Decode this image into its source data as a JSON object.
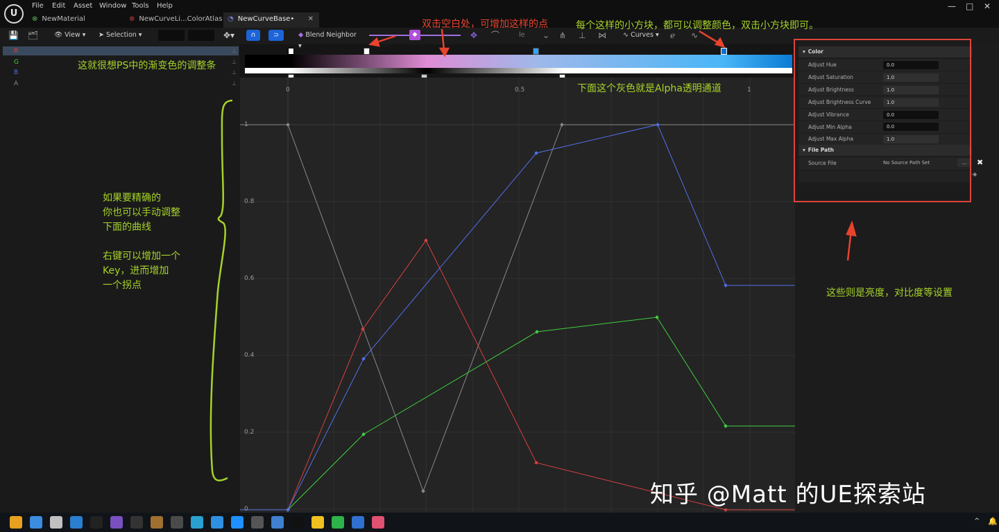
{
  "menu": [
    "File",
    "Edit",
    "Asset",
    "Window",
    "Tools",
    "Help"
  ],
  "tabs": [
    {
      "label": "NewMaterial",
      "active": false
    },
    {
      "label": "NewCurveLi...ColorAtlas•",
      "active": false
    },
    {
      "label": "NewCurveBase•",
      "active": true
    }
  ],
  "window_controls": {
    "minimize": "—",
    "maximize": "□",
    "close": "✕"
  },
  "toolbar": {
    "view_label": "View",
    "selection_label": "Selection",
    "blend_label": "Blend Neighbor",
    "curves_label": "Curves",
    "scale_partial": "le"
  },
  "channels": [
    {
      "label": "R",
      "color": "#d94040"
    },
    {
      "label": "G",
      "color": "#40d040"
    },
    {
      "label": "B",
      "color": "#5070e8"
    },
    {
      "label": "A",
      "color": "#8a8a8a"
    }
  ],
  "graph": {
    "x_ticks": [
      "0",
      "0.5",
      "1"
    ],
    "y_ticks": [
      "1",
      "0.8",
      "0.6",
      "0.4",
      "0.2",
      "0"
    ]
  },
  "details": {
    "color_section": "Color",
    "rows": [
      {
        "label": "Adjust Hue",
        "value": "0.0"
      },
      {
        "label": "Adjust Saturation",
        "value": "1.0"
      },
      {
        "label": "Adjust Brightness",
        "value": "1.0"
      },
      {
        "label": "Adjust Brightness Curve",
        "value": "1.0"
      },
      {
        "label": "Adjust Vibrance",
        "value": "0.0"
      },
      {
        "label": "Adjust Min Alpha",
        "value": "0.0"
      },
      {
        "label": "Adjust Max Alpha",
        "value": "1.0"
      }
    ],
    "file_section": "File Path",
    "source_label": "Source File",
    "source_value": "No Source Path Set",
    "browse_label": "..."
  },
  "annotations": {
    "double_click_add": "双击空白处，可增加这样的点",
    "each_square": "每个这样的小方块，都可以调整颜色，双击小方块即可。",
    "ps_gradient": "这就很想PS中的渐变色的调整条",
    "alpha_channel": "下面这个灰色就是Alpha透明通道",
    "precise_lines": [
      "如果要精确的",
      "你也可以手动调整",
      "下面的曲线",
      "",
      "右键可以增加一个",
      "Key，进而增加",
      "一个拐点"
    ],
    "brightness": "这些则是亮度，对比度等设置"
  },
  "watermark": "知乎 @Matt 的UE探索站",
  "taskbar_apps": [
    "files",
    "chrome",
    "avatar",
    "vscode",
    "unity",
    "vs",
    "terminal",
    "blender",
    "box",
    "app",
    "app2",
    "qq",
    "app3",
    "app4",
    "ue",
    "notes",
    "wechat",
    "app5",
    "app6"
  ]
}
